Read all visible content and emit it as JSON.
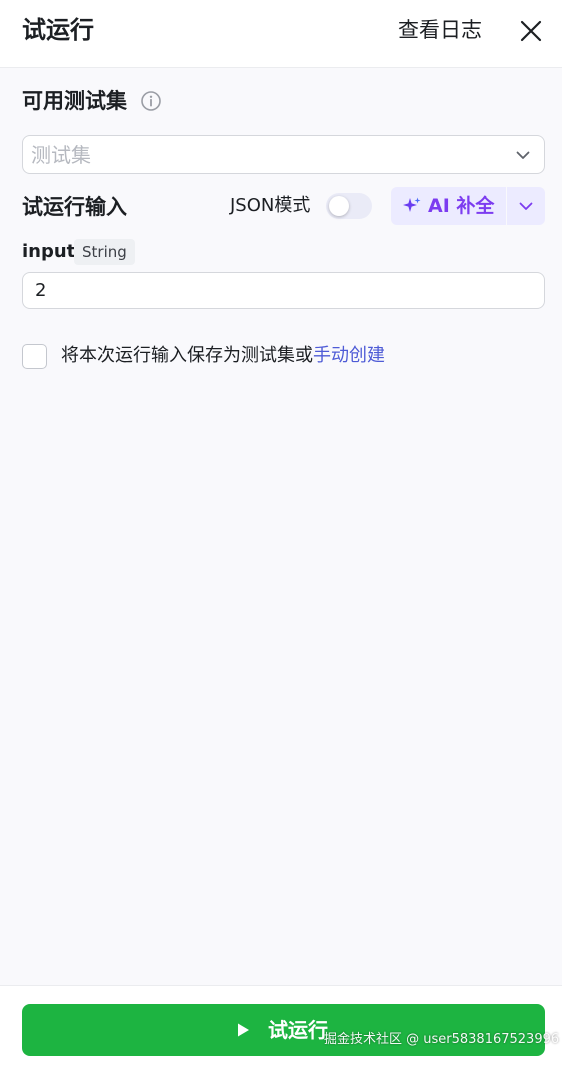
{
  "header": {
    "title": "试运行",
    "logs_label": "查看日志",
    "close_icon": "close-icon"
  },
  "testset": {
    "label": "可用测试集",
    "info_icon": "info-icon",
    "placeholder": "测试集"
  },
  "run_input": {
    "label": "试运行输入",
    "json_mode_label": "JSON模式",
    "json_mode_on": false,
    "ai_button_label": "AI 补全"
  },
  "params": [
    {
      "name": "input",
      "type": "String",
      "value": "2"
    }
  ],
  "save_option": {
    "checked": false,
    "text": "将本次运行输入保存为测试集或",
    "link_text": "手动创建"
  },
  "footer": {
    "run_label": "试运行",
    "watermark": "掘金技术社区 @ user5838167523996"
  },
  "colors": {
    "primary_green": "#1db441",
    "ai_accent": "#7c3cf0",
    "link": "#4e5bd6"
  }
}
